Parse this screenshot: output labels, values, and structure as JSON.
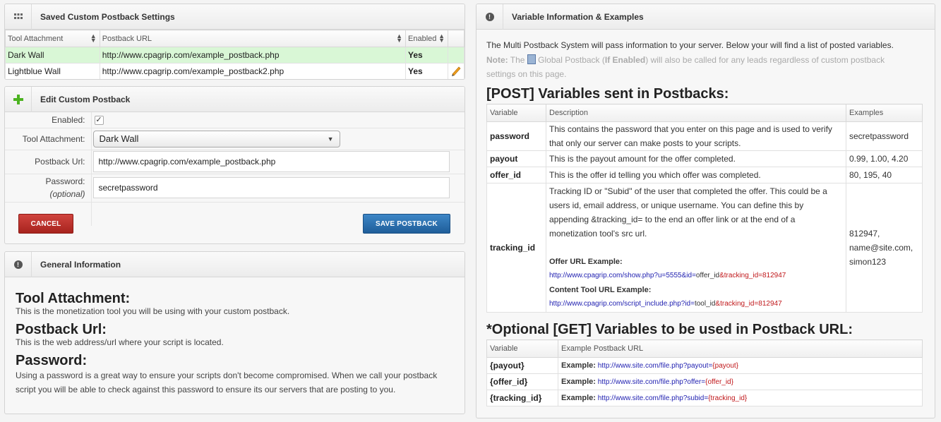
{
  "saved": {
    "title": "Saved Custom Postback Settings",
    "icon": "grid-icon",
    "columns": [
      "Tool Attachment",
      "Postback URL",
      "Enabled"
    ],
    "rows": [
      {
        "tool": "Dark Wall",
        "url": "http://www.cpagrip.com/example_postback.php",
        "enabled": "Yes"
      },
      {
        "tool": "Lightblue Wall",
        "url": "http://www.cpagrip.com/example_postback2.php",
        "enabled": "Yes"
      }
    ]
  },
  "edit": {
    "title": "Edit Custom Postback",
    "icon": "plus-icon",
    "enabled_label": "Enabled:",
    "tool_label": "Tool Attachment:",
    "tool_value": "Dark Wall",
    "url_label": "Postback Url:",
    "url_value": "http://www.cpagrip.com/example_postback.php",
    "password_label": "Password:",
    "password_optional": "(optional)",
    "password_value": "secretpassword",
    "cancel": "CANCEL",
    "save": "SAVE POSTBACK"
  },
  "general": {
    "title": "General Information",
    "sections": [
      {
        "heading": "Tool Attachment:",
        "text": "This is the monetization tool you will be using with your custom postback."
      },
      {
        "heading": "Postback Url:",
        "text": "This is the web address/url where your script is located."
      },
      {
        "heading": "Password:",
        "text": "Using a password is a great way to ensure your scripts don't become compromised. When we call your postback script you will be able to check against this password to ensure its our servers that are posting to you."
      }
    ]
  },
  "vars": {
    "title": "Variable Information & Examples",
    "intro": "The Multi Postback System will pass information to your server. Below your will find a list of posted variables.",
    "note_label": "Note:",
    "note_the": "The",
    "note_global": "Global Postback (",
    "note_if": "If Enabled",
    "note_rest": ") will also be called for any leads regardless of custom postback settings on this page.",
    "post_heading": "[POST] Variables sent in Postbacks:",
    "post_columns": [
      "Variable",
      "Description",
      "Examples"
    ],
    "post_rows": [
      {
        "name": "password",
        "desc": "This contains the password that you enter on this page and is used to verify that only our server can make posts to your scripts.",
        "ex": "secretpassword"
      },
      {
        "name": "payout",
        "desc": "This is the payout amount for the offer completed.",
        "ex": "0.99, 1.00, 4.20"
      },
      {
        "name": "offer_id",
        "desc": "This is the offer id telling you which offer was completed.",
        "ex": "80, 195, 40"
      }
    ],
    "tracking": {
      "name": "tracking_id",
      "desc": "Tracking ID or \"Subid\" of the user that completed the offer. This could be a users id, email address, or unique username. You can define this by appending &tracking_id= to the end an offer link or at the end of a monetization tool's src url.",
      "offer_label": "Offer URL Example:",
      "offer_url_base": "http://www.cpagrip.com/show.php?u=5555&id=",
      "offer_url_mid": "offer_id",
      "offer_url_end": "&tracking_id=812947",
      "content_label": "Content Tool URL Example:",
      "content_url_base": "http://www.cpagrip.com/script_include.php?id=",
      "content_url_mid": "tool_id",
      "content_url_end": "&tracking_id=812947",
      "ex1": "812947,",
      "ex2": "name@site.com,",
      "ex3": "simon123"
    },
    "get_heading": "*Optional [GET] Variables to be used in Postback URL:",
    "get_columns": [
      "Variable",
      "Example Postback URL"
    ],
    "get_rows": [
      {
        "name": "{payout}",
        "label": "Example:",
        "base": "http://www.site.com/file.php?payout=",
        "param": "{payout}"
      },
      {
        "name": "{offer_id}",
        "label": "Example:",
        "base": "http://www.site.com/file.php?offer=",
        "param": "{offer_id}"
      },
      {
        "name": "{tracking_id}",
        "label": "Example:",
        "base": "http://www.site.com/file.php?subid=",
        "param": "{tracking_id}"
      }
    ]
  }
}
